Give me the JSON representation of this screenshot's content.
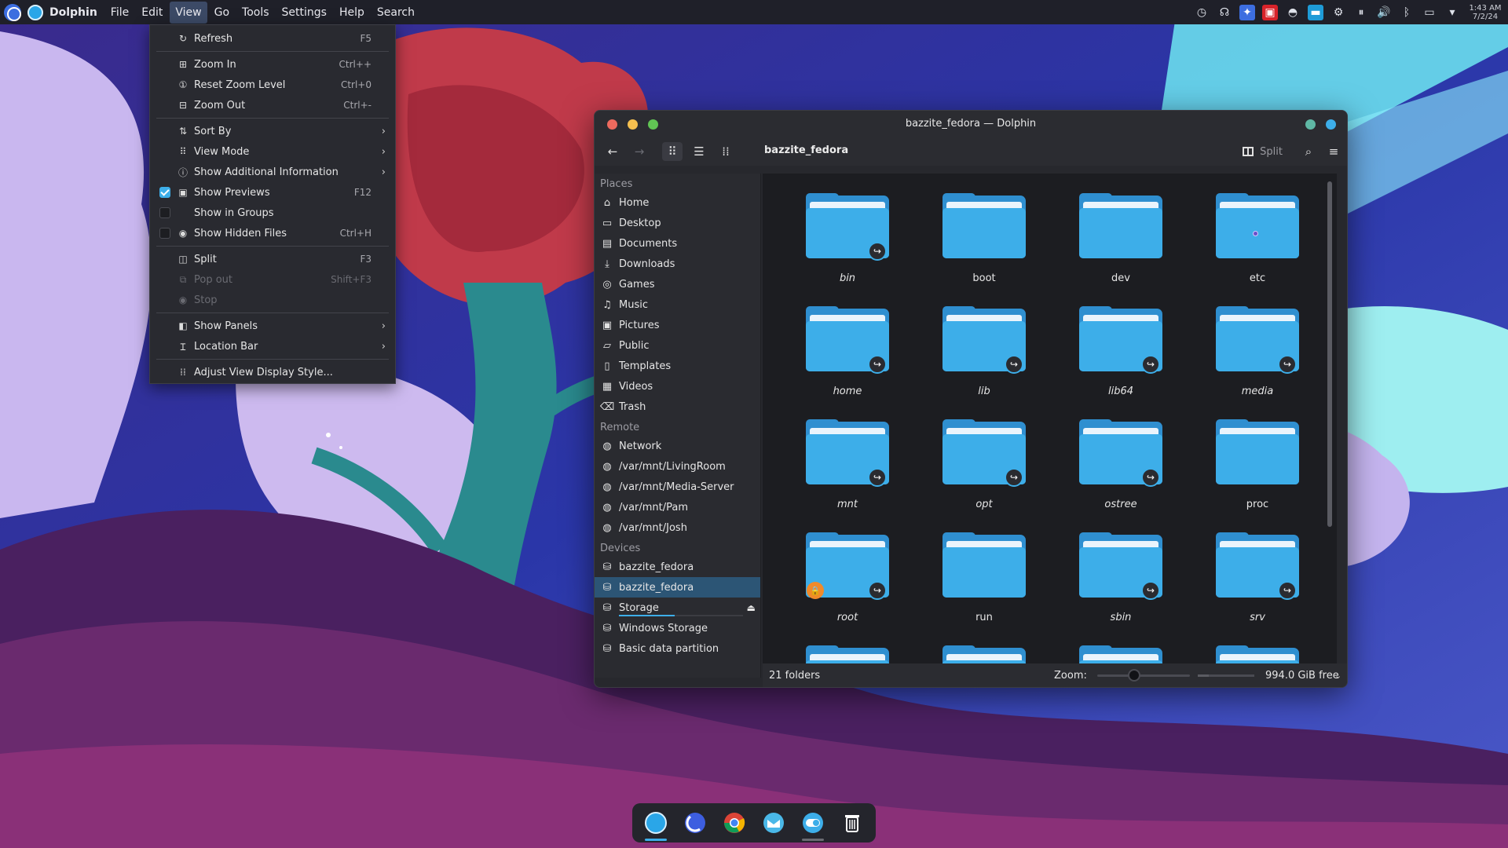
{
  "topbar": {
    "app_name": "Dolphin",
    "menus": [
      "File",
      "Edit",
      "View",
      "Go",
      "Tools",
      "Settings",
      "Help",
      "Search"
    ],
    "active_menu": "View",
    "clock_time": "1:43 AM",
    "clock_date": "7/2/24"
  },
  "view_menu": {
    "items": [
      {
        "type": "item",
        "icon": "refresh-icon",
        "label": "Refresh",
        "shortcut": "F5"
      },
      {
        "type": "sep"
      },
      {
        "type": "item",
        "icon": "zoom-in-icon",
        "label": "Zoom In",
        "shortcut": "Ctrl++"
      },
      {
        "type": "item",
        "icon": "reset-zoom-icon",
        "label": "Reset Zoom Level",
        "shortcut": "Ctrl+0"
      },
      {
        "type": "item",
        "icon": "zoom-out-icon",
        "label": "Zoom Out",
        "shortcut": "Ctrl+-"
      },
      {
        "type": "sep"
      },
      {
        "type": "item",
        "icon": "sort-icon",
        "label": "Sort By",
        "submenu": true
      },
      {
        "type": "item",
        "icon": "view-mode-icon",
        "label": "View Mode",
        "submenu": true
      },
      {
        "type": "item",
        "icon": "info-icon",
        "label": "Show Additional Information",
        "submenu": true
      },
      {
        "type": "item",
        "icon": "image-icon",
        "label": "Show Previews",
        "shortcut": "F12",
        "checkbox": true,
        "checked": true
      },
      {
        "type": "item",
        "icon": "none",
        "label": "Show in Groups",
        "checkbox": true,
        "checked": false
      },
      {
        "type": "item",
        "icon": "eye-icon",
        "label": "Show Hidden Files",
        "shortcut": "Ctrl+H",
        "checkbox": true,
        "checked": false
      },
      {
        "type": "sep"
      },
      {
        "type": "item",
        "icon": "split-icon",
        "label": "Split",
        "shortcut": "F3"
      },
      {
        "type": "item",
        "icon": "pop-out-icon",
        "label": "Pop out",
        "shortcut": "Shift+F3",
        "disabled": true
      },
      {
        "type": "item",
        "icon": "stop-icon",
        "label": "Stop",
        "disabled": true
      },
      {
        "type": "sep"
      },
      {
        "type": "item",
        "icon": "panels-icon",
        "label": "Show Panels",
        "submenu": true
      },
      {
        "type": "item",
        "icon": "location-bar-icon",
        "label": "Location Bar",
        "submenu": true
      },
      {
        "type": "sep"
      },
      {
        "type": "item",
        "icon": "view-style-icon",
        "label": "Adjust View Display Style..."
      }
    ]
  },
  "window": {
    "title": "bazzite_fedora — Dolphin",
    "breadcrumb": "bazzite_fedora",
    "split_label": "Split",
    "colors": {
      "close": "#ed6a5e",
      "minimize": "#f5bf4f",
      "maximize": "#61c554",
      "accent": "#3daee9"
    }
  },
  "sidebar": {
    "sections": [
      {
        "header": "Places",
        "items": [
          {
            "icon": "home-icon",
            "label": "Home"
          },
          {
            "icon": "desktop-icon",
            "label": "Desktop"
          },
          {
            "icon": "documents-icon",
            "label": "Documents"
          },
          {
            "icon": "downloads-icon",
            "label": "Downloads"
          },
          {
            "icon": "games-icon",
            "label": "Games"
          },
          {
            "icon": "music-icon",
            "label": "Music"
          },
          {
            "icon": "pictures-icon",
            "label": "Pictures"
          },
          {
            "icon": "public-icon",
            "label": "Public"
          },
          {
            "icon": "templates-icon",
            "label": "Templates"
          },
          {
            "icon": "videos-icon",
            "label": "Videos"
          },
          {
            "icon": "trash-icon",
            "label": "Trash"
          }
        ]
      },
      {
        "header": "Remote",
        "items": [
          {
            "icon": "network-icon",
            "label": "Network"
          },
          {
            "icon": "network-share-icon",
            "label": "/var/mnt/LivingRoom"
          },
          {
            "icon": "network-share-icon",
            "label": "/var/mnt/Media-Server"
          },
          {
            "icon": "network-share-icon",
            "label": "/var/mnt/Pam"
          },
          {
            "icon": "network-share-icon",
            "label": "/var/mnt/Josh"
          }
        ]
      },
      {
        "header": "Devices",
        "items": [
          {
            "icon": "drive-icon",
            "label": "bazzite_fedora"
          },
          {
            "icon": "drive-icon",
            "label": "bazzite_fedora",
            "selected": true
          },
          {
            "icon": "drive-icon",
            "label": "Storage",
            "eject": true,
            "usage": 0.45
          },
          {
            "icon": "drive-icon",
            "label": "Windows Storage"
          },
          {
            "icon": "drive-icon",
            "label": "Basic data partition"
          }
        ]
      }
    ]
  },
  "folders": [
    {
      "name": "bin",
      "link": true,
      "italic": true
    },
    {
      "name": "boot"
    },
    {
      "name": "dev"
    },
    {
      "name": "etc",
      "emblem": "dot"
    },
    {
      "name": "home",
      "link": true,
      "italic": true
    },
    {
      "name": "lib",
      "link": true,
      "italic": true
    },
    {
      "name": "lib64",
      "link": true,
      "italic": true
    },
    {
      "name": "media",
      "link": true,
      "italic": true
    },
    {
      "name": "mnt",
      "link": true,
      "italic": true
    },
    {
      "name": "opt",
      "link": true,
      "italic": true
    },
    {
      "name": "ostree",
      "link": true,
      "italic": true
    },
    {
      "name": "proc"
    },
    {
      "name": "root",
      "link": true,
      "italic": true,
      "locked": true
    },
    {
      "name": "run"
    },
    {
      "name": "sbin",
      "link": true,
      "italic": true
    },
    {
      "name": "srv",
      "link": true,
      "italic": true
    }
  ],
  "statusbar": {
    "count": "21 folders",
    "zoom_label": "Zoom:",
    "zoom_level": 0.4,
    "free_space": "994.0 GiB free"
  },
  "dock": {
    "items": [
      "dolphin-icon",
      "bazzite-portal-icon",
      "chrome-icon",
      "mail-icon",
      "toggle-icon",
      "trash-can-icon"
    ]
  }
}
